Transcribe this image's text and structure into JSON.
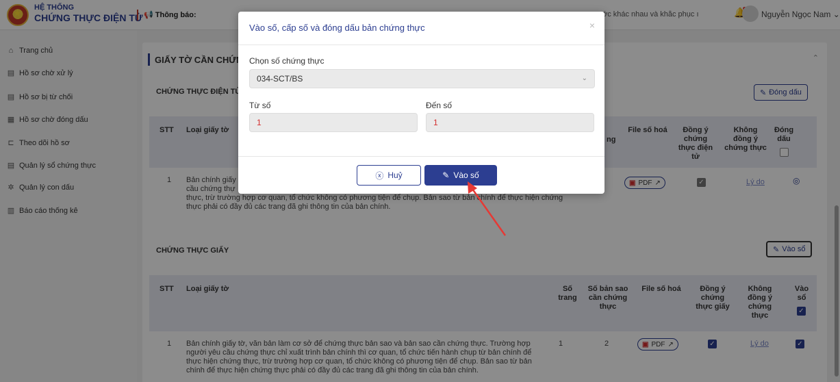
{
  "header": {
    "brand_line1": "HỆ THỐNG",
    "brand_line2": "CHỨNG THỰC ĐIỆN TỬ",
    "notice_label": "Thông báo:",
    "notice_text": "ớc khác nhau và khắc phục ı",
    "user_name": "Nguyễn Ngọc Nam"
  },
  "sidebar": {
    "items": [
      {
        "label": "Trang chủ",
        "icon": "home-icon"
      },
      {
        "label": "Hồ sơ chờ xử lý",
        "icon": "document-icon"
      },
      {
        "label": "Hồ sơ bị từ chối",
        "icon": "document-icon"
      },
      {
        "label": "Hồ sơ chờ đóng dấu",
        "icon": "grid-icon"
      },
      {
        "label": "Theo dõi hồ sơ",
        "icon": "tree-icon"
      },
      {
        "label": "Quản lý sổ chứng thực",
        "icon": "document-icon"
      },
      {
        "label": "Quản lý con dấu",
        "icon": "gear-icon"
      },
      {
        "label": "Báo cáo thống kê",
        "icon": "bar-chart-icon"
      }
    ]
  },
  "main": {
    "section_title": "GIẤY TỜ CẦN CHỨN",
    "electronic": {
      "title": "CHỨNG THỰC ĐIỆN TỬ",
      "stamp_button": "Đóng dấu",
      "headers": {
        "stt": "STT",
        "doc_type": "Loại giấy tờ",
        "pages_partial": "ng",
        "file": "File số hoá",
        "agree": "Đồng ý chứng thực điện tử",
        "disagree": "Không đồng ý chứng thực",
        "stamp": "Đóng dấu"
      },
      "row": {
        "stt": "1",
        "line1": "Bản chính giấy",
        "line2": "cầu chứng thự",
        "line3": "thực, trừ trường hợp cơ quan, tổ chức không có phương tiện để chụp. Bản sao từ bản chính để thực hiện chứng",
        "line4": "thực phải có đầy đủ các trang đã ghi thông tin của bản chính.",
        "file": "PDF",
        "reason": "Lý do"
      }
    },
    "paper": {
      "title": "CHỨNG THỰC GIẤY",
      "record_button": "Vào sổ",
      "headers": {
        "stt": "STT",
        "doc_type": "Loại giấy tờ",
        "pages": "Số trang",
        "copies": "Số bản sao cần chứng thực",
        "file": "File số hoá",
        "agree": "Đồng ý chứng thực giấy",
        "disagree": "Không đồng ý chứng thực",
        "record": "Vào sổ"
      },
      "row": {
        "stt": "1",
        "line1": "Bản chính giấy tờ, văn bản làm cơ sở để chứng thực bản sao và bản sao cần chứng thực. Trường hợp",
        "line2": "người yêu cầu chứng thực chỉ xuất trình bản chính thì cơ quan, tổ chức tiến hành chụp từ bản chính để",
        "line3": "thực hiện chứng thực, trừ trường hợp cơ quan, tổ chức không có phương tiện để chụp. Bản sao từ bản",
        "line4": "chính để thực hiện chứng thực phải có đầy đủ các trang đã ghi thông tin của bản chính.",
        "pages": "1",
        "copies": "2",
        "file": "PDF",
        "reason": "Lý do"
      }
    }
  },
  "modal": {
    "title": "Vào số, cấp số và đóng dấu bản chứng thực",
    "book_label": "Chọn số chứng thực",
    "book_value": "034-SCT/BS",
    "from_label": "Từ số",
    "from_value": "1",
    "to_label": "Đến số",
    "to_value": "1",
    "cancel_label": "Huỷ",
    "ok_label": "Vào số"
  },
  "colors": {
    "primary": "#2c3e91",
    "annotation_arrow": "#e53935"
  }
}
